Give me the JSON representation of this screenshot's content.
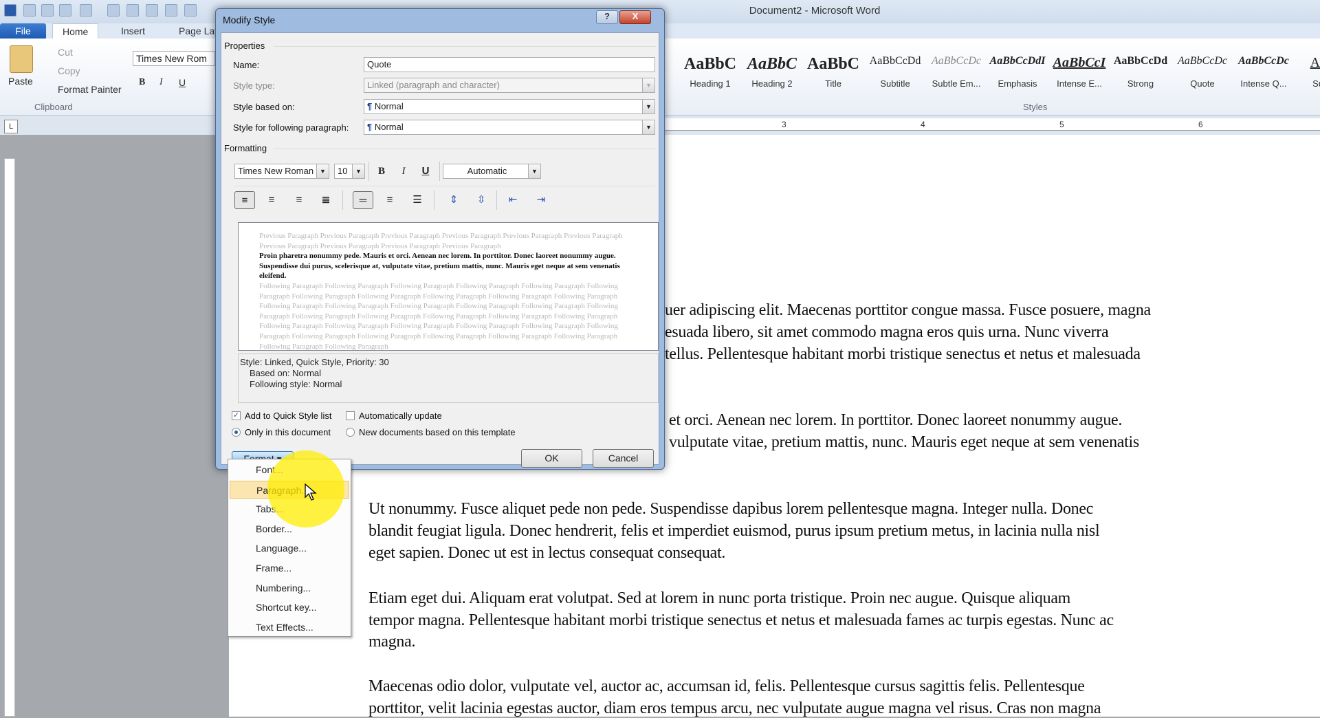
{
  "app": {
    "title": "Document2 - Microsoft Word"
  },
  "ribbon": {
    "tabs": [
      "File",
      "Home",
      "Insert",
      "Page Layout"
    ],
    "clipboard": {
      "paste": "Paste",
      "cut": "Cut",
      "copy": "Copy",
      "format_painter": "Format Painter",
      "group": "Clipboard"
    },
    "font": {
      "name": "Times New Rom",
      "bold": "B",
      "italic": "I",
      "underline": "U"
    },
    "styles": {
      "group": "Styles",
      "items": [
        {
          "sample": "AaBbC",
          "label": "Heading 1"
        },
        {
          "sample": "AaBbC",
          "label": "Heading 2"
        },
        {
          "sample": "AaBbC",
          "label": "Title"
        },
        {
          "sample": "AaBbCcDd",
          "label": "Subtitle"
        },
        {
          "sample": "AaBbCcDc",
          "label": "Subtle Em..."
        },
        {
          "sample": "AaBbCcDdI",
          "label": "Emphasis"
        },
        {
          "sample": "AaBbCcI",
          "label": "Intense E..."
        },
        {
          "sample": "AaBbCcDd",
          "label": "Strong"
        },
        {
          "sample": "AaBbCcDc",
          "label": "Quote"
        },
        {
          "sample": "AaBbCcDc",
          "label": "Intense Q..."
        },
        {
          "sample": "AaB",
          "label": "Subtl"
        }
      ]
    }
  },
  "ruler": {
    "numbers": [
      "3",
      "4",
      "5",
      "6"
    ],
    "corner": "L"
  },
  "document": {
    "lines_right_p1": [
      "uer adipiscing elit. Maecenas porttitor congue massa. Fusce posuere, magna",
      "esuada libero, sit amet commodo magna eros quis urna. Nunc viverra",
      "tellus. Pellentesque habitant morbi tristique senectus et netus et malesuada"
    ],
    "lines_right_p2": [
      "et orci. Aenean nec lorem. In porttitor. Donec laoreet nonummy augue.",
      "vulputate vitae, pretium mattis, nunc. Mauris eget neque at sem venenatis"
    ],
    "p3": [
      "Ut nonummy. Fusce aliquet pede non pede. Suspendisse dapibus lorem pellentesque magna. Integer nulla. Donec",
      "blandit feugiat ligula. Donec hendrerit, felis et imperdiet euismod, purus ipsum pretium metus, in lacinia nulla nisl",
      "eget sapien. Donec ut est in lectus consequat consequat."
    ],
    "p4": [
      "Etiam eget dui. Aliquam erat volutpat. Sed at lorem in nunc porta tristique. Proin nec augue. Quisque aliquam",
      "tempor magna. Pellentesque habitant morbi tristique senectus et netus et malesuada fames ac turpis egestas. Nunc ac",
      "magna."
    ],
    "p5": [
      "Maecenas odio dolor, vulputate vel, auctor ac, accumsan id, felis. Pellentesque cursus sagittis felis. Pellentesque",
      "porttitor, velit lacinia egestas auctor, diam eros tempus arcu, nec vulputate augue magna vel risus. Cras non magna"
    ]
  },
  "dialog": {
    "title": "Modify Style",
    "help": "?",
    "close": "X",
    "properties_label": "Properties",
    "name_label": "Name:",
    "name_value": "Quote",
    "style_type_label": "Style type:",
    "style_type_value": "Linked (paragraph and character)",
    "based_on_label": "Style based on:",
    "based_on_value": "Normal",
    "following_label": "Style for following paragraph:",
    "following_value": "Normal",
    "formatting_label": "Formatting",
    "font_value": "Times New Roman",
    "size_value": "10",
    "bold": "B",
    "italic": "I",
    "underline": "U",
    "color_value": "Automatic",
    "preview": {
      "previous": "Previous Paragraph Previous Paragraph Previous Paragraph Previous Paragraph Previous Paragraph Previous Paragraph Previous Paragraph Previous Paragraph Previous Paragraph Previous Paragraph",
      "sample": "Proin pharetra nonummy pede. Mauris et orci. Aenean nec lorem. In porttitor. Donec laoreet nonummy augue. Suspendisse dui purus, scelerisque at, vulputate vitae, pretium mattis, nunc. Mauris eget neque at sem venenatis eleifend.",
      "following": "Following Paragraph Following Paragraph Following Paragraph Following Paragraph Following Paragraph Following Paragraph Following Paragraph Following Paragraph Following Paragraph Following Paragraph Following Paragraph Following Paragraph Following Paragraph Following Paragraph Following Paragraph Following Paragraph Following Paragraph Following Paragraph Following Paragraph Following Paragraph Following Paragraph Following Paragraph Following Paragraph Following Paragraph Following Paragraph Following Paragraph Following Paragraph Following Paragraph Following Paragraph Following Paragraph Following Paragraph Following Paragraph Following Paragraph Following Paragraph Following Paragraph"
    },
    "description": [
      "Style: Linked, Quick Style, Priority: 30",
      "Based on: Normal",
      "Following style: Normal"
    ],
    "add_quick_style": {
      "label": "Add to Quick Style list",
      "checked": true
    },
    "auto_update": {
      "label": "Automatically update",
      "checked": false
    },
    "only_doc": {
      "label": "Only in this document",
      "selected": true
    },
    "new_docs": {
      "label": "New documents based on this template",
      "selected": false
    },
    "format_button": "Format ▾",
    "ok": "OK",
    "cancel": "Cancel"
  },
  "format_menu": {
    "items": [
      "Font...",
      "Paragraph...",
      "Tabs...",
      "Border...",
      "Language...",
      "Frame...",
      "Numbering...",
      "Shortcut key...",
      "Text Effects..."
    ],
    "highlighted": "Paragraph..."
  },
  "colors": {
    "file_tab": "#2a6bc4",
    "highlight": "#fbe6b0",
    "cursor_spot": "#ffee00"
  }
}
